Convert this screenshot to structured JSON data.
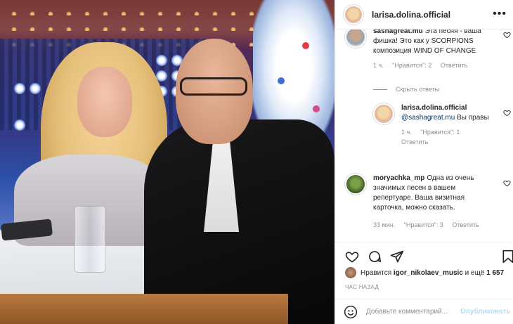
{
  "header": {
    "username": "larisa.dolina.official",
    "more_icon": "more-horizontal-icon"
  },
  "comments": [
    {
      "username": "sashagreat.mu",
      "text": "Эта песня - ваша фишка! Это как у SCORPIONS композиция WIND OF CHANGE",
      "time": "1 ч.",
      "likes": "\"Нравится\": 2",
      "reply": "Ответить"
    },
    {
      "username": "larisa.dolina.official",
      "mention": "@sashagreat.mu",
      "text": "Вы правы",
      "time": "1 ч.",
      "likes": "\"Нравится\": 1",
      "reply": "Ответить"
    },
    {
      "username": "moryachka_mp",
      "text": "Одна из очень значимых песен в вашем репертуаре. Ваша визитная карточка, можно сказать.",
      "time": "33 мин.",
      "likes": "\"Нравится\": 3",
      "reply": "Ответить"
    }
  ],
  "hide_replies": "Скрыть ответы",
  "actions": {
    "like_icon": "heart-icon",
    "comment_icon": "comment-icon",
    "share_icon": "send-icon",
    "save_icon": "bookmark-icon"
  },
  "likes": {
    "prefix": "Нравится",
    "user": "igor_nikolaev_music",
    "middle": "и ещё",
    "count": "1 657"
  },
  "timestamp": "ЧАС НАЗАД",
  "add_comment": {
    "emoji_icon": "smile-icon",
    "placeholder": "Добавьте комментарий...",
    "publish": "Опубликовать"
  },
  "colors": {
    "link": "#00376b",
    "muted": "#8e8e8e",
    "publish_disabled": "#b2dffc"
  }
}
